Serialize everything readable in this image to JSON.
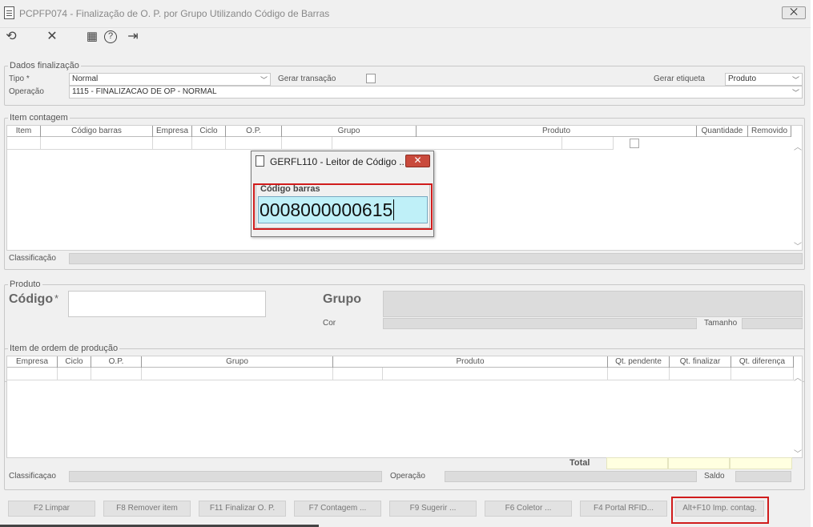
{
  "window": {
    "title": "PCPFP074 - Finalização de O. P.  por Grupo Utilizando Código de Barras",
    "close_label": "⨉"
  },
  "toolbar": {
    "icons": [
      "refresh-icon",
      "close-icon",
      "calendar-icon",
      "help-icon",
      "exit-icon"
    ],
    "refresh": "⟲",
    "close": "✕",
    "calendar": "▦",
    "help": "?",
    "exit": "⇥"
  },
  "dados": {
    "legend": "Dados finalização",
    "tipo_label": "Tipo *",
    "tipo_value": "Normal",
    "gerar_transacao_label": "Gerar transação",
    "gerar_etiqueta_label": "Gerar etiqueta",
    "gerar_etiqueta_value": "Produto",
    "operacao_label": "Operação",
    "operacao_value": "1115 - FINALIZACAO DE OP - NORMAL"
  },
  "item_contagem": {
    "legend": "Item contagem",
    "columns": [
      "Item",
      "Código barras",
      "Empresa",
      "Ciclo",
      "O.P.",
      "Grupo",
      "Produto",
      "Quantidade",
      "Removido"
    ],
    "classificacao_label": "Classificação"
  },
  "produto": {
    "legend": "Produto",
    "codigo_label": "Código",
    "required_mark": "*",
    "grupo_label": "Grupo",
    "cor_label": "Cor",
    "tamanho_label": "Tamanho"
  },
  "item_ordem": {
    "legend": "Item de ordem de produção",
    "columns": [
      "Empresa",
      "Ciclo",
      "O.P.",
      "Grupo",
      "Produto",
      "Qt. pendente",
      "Qt. finalizar",
      "Qt. diferença"
    ],
    "total_label": "Total",
    "classificacao_label": "Classificaçao",
    "operacao_label": "Operação",
    "saldo_label": "Saldo"
  },
  "buttons": {
    "limpar": "F2 Limpar",
    "remover": "F8 Remover item",
    "finalizar": "F11 Finalizar O. P.",
    "contagem": "F7 Contagem ...",
    "sugerir": "F9 Sugerir ...",
    "coletor": "F6 Coletor ...",
    "portal": "F4 Portal RFID...",
    "imp": "Alt+F10 Imp. contag."
  },
  "dialog": {
    "title": "GERFL110 - Leitor de Código ...",
    "close_label": "✕",
    "legend": "Código barras",
    "value": "0008000000615"
  },
  "colors": {
    "highlight": "#d01c1c",
    "dialog_input_bg": "#bff0f8",
    "total_bg": "#ffffe0"
  }
}
